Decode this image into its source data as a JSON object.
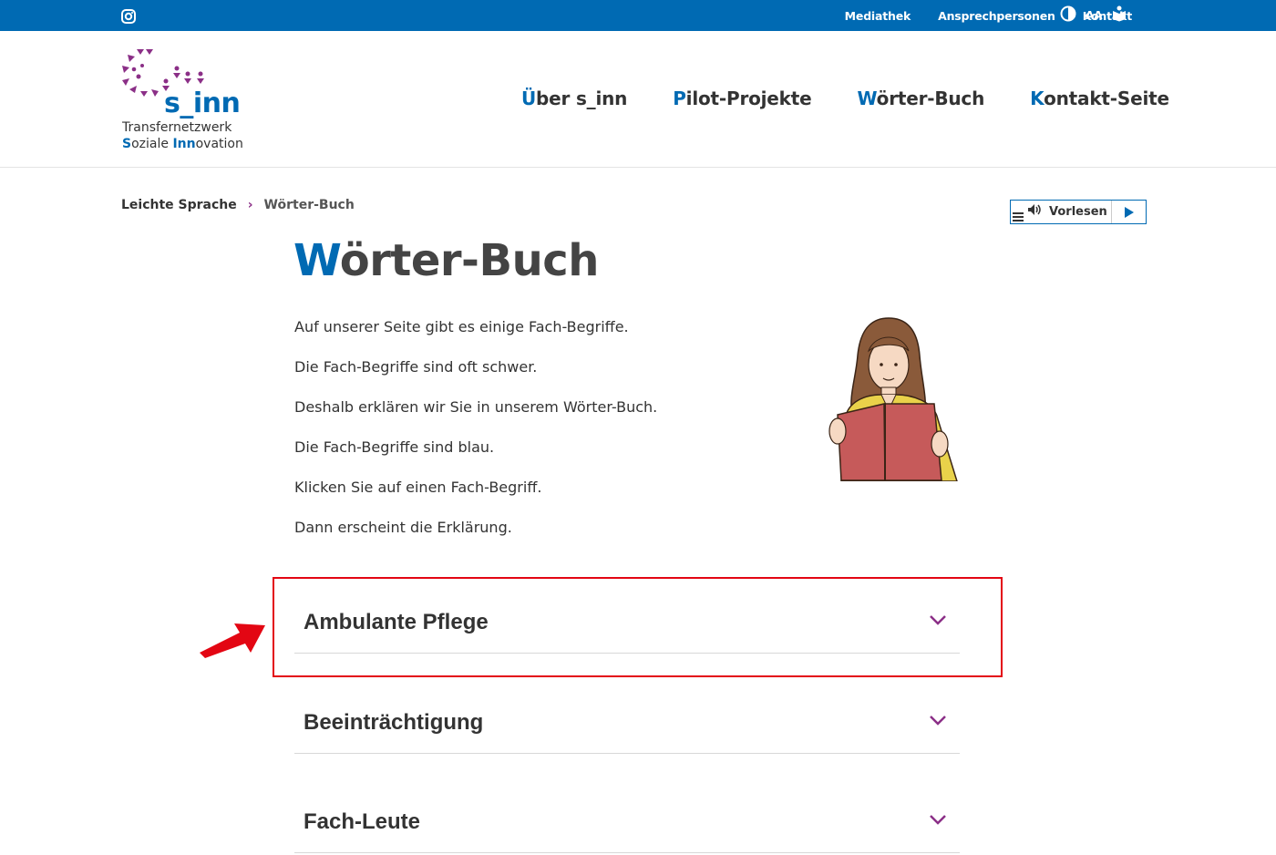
{
  "topbar": {
    "instagram_icon": "instagram-icon",
    "links": [
      "Mediathek",
      "Ansprechpersonen",
      "Kontakt"
    ],
    "icons": [
      "contrast-icon",
      "font-size-icon",
      "accessibility-book-icon"
    ],
    "font_size_label": "AA",
    "bg_color": "#006ab3"
  },
  "logo": {
    "brand": "s_inn",
    "line1": "Transfernetzwerk",
    "line2_s": "S",
    "line2_a": "oziale ",
    "line2_inn": "Inn",
    "line2_b": "ovation"
  },
  "nav": [
    {
      "first": "Ü",
      "rest": "ber s_inn"
    },
    {
      "first": "P",
      "rest": "ilot-Projekte"
    },
    {
      "first": "W",
      "rest": "örter-Buch"
    },
    {
      "first": "K",
      "rest": "ontakt-Seite"
    }
  ],
  "breadcrumb": {
    "home": "Leichte Sprache",
    "separator": "›",
    "current": "Wörter-Buch"
  },
  "vorlesen": {
    "label": "Vorlesen"
  },
  "page": {
    "title_first": "W",
    "title_rest": "örter-Buch",
    "intro": [
      "Auf unserer Seite gibt es einige Fach-Begriffe.",
      "Die Fach-Begriffe sind oft schwer.",
      "Deshalb erklären wir Sie in unserem Wörter-Buch.",
      "Die Fach-Begriffe sind blau.",
      "Klicken Sie auf einen Fach-Begriff.",
      "Dann erscheint die Erklärung."
    ]
  },
  "accordion": [
    {
      "title": "Ambulante Pflege"
    },
    {
      "title": "Beeinträchtigung"
    },
    {
      "title": "Fach-Leute"
    }
  ],
  "colors": {
    "accent_blue": "#006ab3",
    "accent_purple": "#8b2f87",
    "highlight_red": "#e30613"
  }
}
